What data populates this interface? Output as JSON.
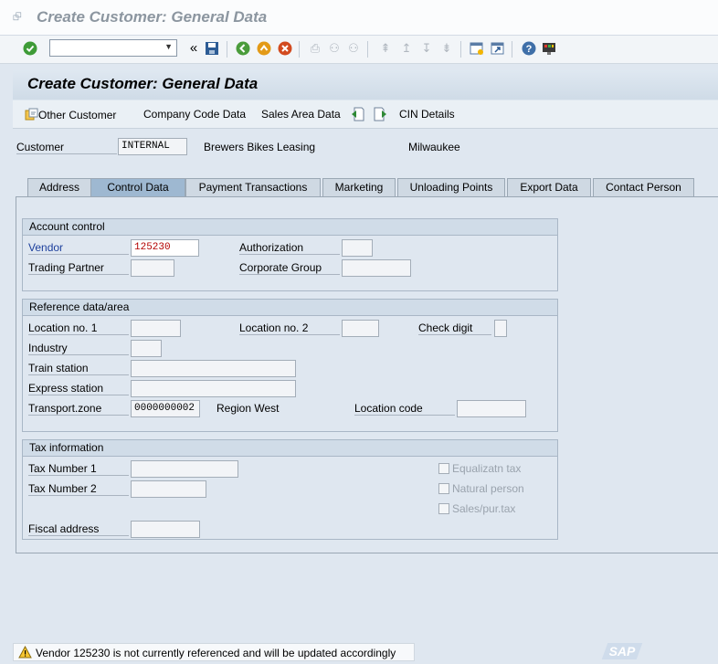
{
  "window": {
    "title": "Create Customer: General Data"
  },
  "screen": {
    "title": "Create Customer: General Data"
  },
  "app_toolbar": {
    "other_customer": "Other Customer",
    "company_code_data": "Company Code Data",
    "sales_area_data": "Sales Area Data",
    "cin_details": "CIN Details"
  },
  "header": {
    "customer_label": "Customer",
    "customer_value": "INTERNAL",
    "customer_name": "Brewers Bikes Leasing",
    "city": "Milwaukee"
  },
  "tabs": [
    "Address",
    "Control Data",
    "Payment Transactions",
    "Marketing",
    "Unloading Points",
    "Export Data",
    "Contact Person"
  ],
  "active_tab": "Control Data",
  "account_control": {
    "title": "Account control",
    "vendor_label": "Vendor",
    "vendor_value": "125230",
    "authorization_label": "Authorization",
    "trading_partner_label": "Trading Partner",
    "corporate_group_label": "Corporate Group"
  },
  "reference_data": {
    "title": "Reference data/area",
    "location_no1_label": "Location no. 1",
    "location_no2_label": "Location no. 2",
    "check_digit_label": "Check digit",
    "industry_label": "Industry",
    "train_station_label": "Train station",
    "express_station_label": "Express station",
    "transport_zone_label": "Transport.zone",
    "transport_zone_value": "0000000002",
    "transport_zone_desc": "Region West",
    "location_code_label": "Location code"
  },
  "tax_info": {
    "title": "Tax information",
    "tax_number1_label": "Tax Number 1",
    "tax_number2_label": "Tax Number 2",
    "fiscal_address_label": "Fiscal address",
    "equalization_tax_label": "Equalizatn tax",
    "natural_person_label": "Natural person",
    "sales_pur_tax_label": "Sales/pur.tax"
  },
  "status": {
    "message": "Vendor 125230 is not currently referenced and will be updated accordingly"
  },
  "colors": {
    "accent": "#1c3f9c",
    "required_value": "#b30000"
  },
  "brand": {
    "logo_text": "SAP"
  }
}
